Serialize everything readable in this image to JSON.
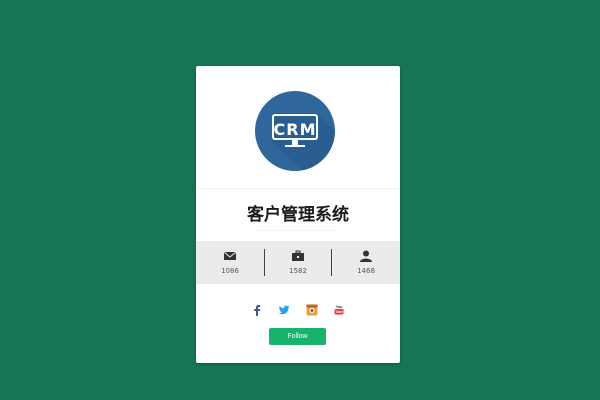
{
  "colors": {
    "page_background": "#157556",
    "card_background": "#ffffff",
    "logo_circle": "#2f679c",
    "logo_shadow": "#27578a",
    "stats_background": "#ebebeb",
    "follow_button": "#17b26b"
  },
  "profile": {
    "logo_text": "CRM",
    "logo_icon": "monitor-icon",
    "title": "客户管理系统"
  },
  "stats": [
    {
      "icon": "mail-icon",
      "value": "1086"
    },
    {
      "icon": "briefcase-icon",
      "value": "1582"
    },
    {
      "icon": "user-icon",
      "value": "1468"
    }
  ],
  "social": [
    {
      "icon": "facebook-icon",
      "color": "#3b5998"
    },
    {
      "icon": "twitter-icon",
      "color": "#1da1f2"
    },
    {
      "icon": "instagram-icon",
      "color": "#e2a33a"
    },
    {
      "icon": "youtube-icon",
      "color": "#e53935"
    }
  ],
  "actions": {
    "follow_label": "Follow"
  }
}
